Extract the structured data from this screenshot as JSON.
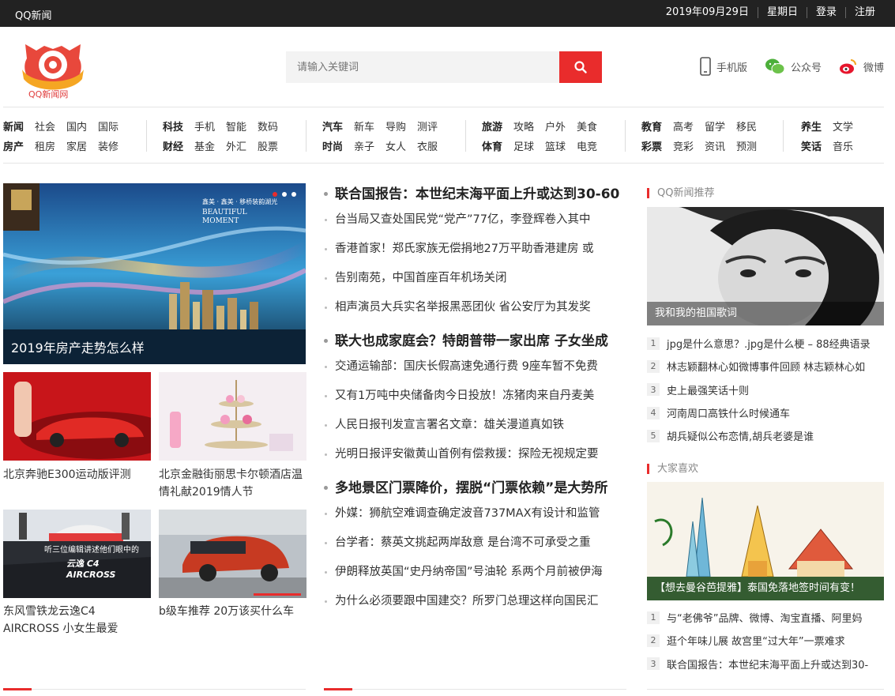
{
  "topbar": {
    "brand": "QQ新闻",
    "date": "2019年09月29日",
    "weekday": "星期日",
    "login": "登录",
    "register": "注册"
  },
  "header": {
    "logo_text": "QQ新闻网",
    "search_placeholder": "请输入关键词",
    "links": {
      "mobile": "手机版",
      "wechat": "公众号",
      "weibo": "微博"
    }
  },
  "nav": {
    "groups": [
      {
        "row1": [
          "新闻",
          "社会",
          "国内",
          "国际"
        ],
        "row2": [
          "房产",
          "租房",
          "家居",
          "装修"
        ]
      },
      {
        "row1": [
          "科技",
          "手机",
          "智能",
          "数码"
        ],
        "row2": [
          "财经",
          "基金",
          "外汇",
          "股票"
        ]
      },
      {
        "row1": [
          "汽车",
          "新车",
          "导购",
          "测评"
        ],
        "row2": [
          "时尚",
          "亲子",
          "女人",
          "衣服"
        ]
      },
      {
        "row1": [
          "旅游",
          "攻略",
          "户外",
          "美食"
        ],
        "row2": [
          "体育",
          "足球",
          "篮球",
          "电竞"
        ]
      },
      {
        "row1": [
          "教育",
          "高考",
          "留学",
          "移民"
        ],
        "row2": [
          "彩票",
          "竞彩",
          "资讯",
          "预测"
        ]
      },
      {
        "row1": [
          "养生",
          "文学"
        ],
        "row2": [
          "笑话",
          "音乐"
        ]
      }
    ]
  },
  "hero": {
    "caption": "2019年房产走势怎么样",
    "banner_lines": [
      "鑫美 · 鑫美 · 移桥装韵湖光",
      "BEAUTIFUL",
      "MOMENT"
    ]
  },
  "thumbs": [
    {
      "caption": "北京奔驰E300运动版评测"
    },
    {
      "caption": "北京金融街丽思卡尔顿酒店温情礼献2019情人节"
    },
    {
      "caption": "东风雪铁龙云逸C4 AIRCROSS 小女生最爱",
      "overlay1": "听三位编辑讲述他们眼中的",
      "overlay2": "云逸 C4 AIRCROSS"
    },
    {
      "caption": "b级车推荐 20万该买什么车"
    }
  ],
  "middle": {
    "sections": [
      {
        "headline": "联合国报告：本世纪末海平面上升或达到30-60",
        "items": [
          "台当局又查处国民党“党产”77亿，李登辉卷入其中",
          "香港首家！郑氏家族无偿捐地27万平助香港建房 或",
          "告别南苑，中国首座百年机场关闭",
          "相声演员大兵实名举报黑恶团伙 省公安厅为其发奖"
        ]
      },
      {
        "headline": "联大也成家庭会？特朗普带一家出席 子女坐成",
        "items": [
          "交通运输部：国庆长假高速免通行费 9座车暂不免费",
          "又有1万吨中央储备肉今日投放！冻猪肉来自丹麦美",
          "人民日报刊发宣言署名文章：雄关漫道真如铁",
          "光明日报评安徽黄山首例有偿救援：探险无视规定要"
        ]
      },
      {
        "headline": "多地景区门票降价，摆脱“门票依赖”是大势所",
        "items": [
          "外媒：狮航空难调查确定波音737MAX有设计和监管",
          "台学者：蔡英文挑起两岸敌意 是台湾不可承受之重",
          "伊朗释放英国“史丹纳帝国”号油轮 系两个月前被伊海",
          "为什么必须要跟中国建交？所罗门总理这样向国民汇"
        ]
      }
    ]
  },
  "right": {
    "recommend": {
      "title": "QQ新闻推荐",
      "image_caption": "我和我的祖国歌词",
      "items": [
        {
          "n": "1",
          "text": "jpg是什么意思？.jpg是什么梗 – 88经典语录"
        },
        {
          "n": "2",
          "text": "林志颖翻林心如微博事件回顾 林志颖林心如"
        },
        {
          "n": "3",
          "text": "史上最强笑话十则"
        },
        {
          "n": "4",
          "text": "河南周口高铁什么时候通车"
        },
        {
          "n": "5",
          "text": "胡兵疑似公布恋情,胡兵老婆是谁"
        }
      ]
    },
    "likes": {
      "title": "大家喜欢",
      "image_caption": "【想去曼谷芭提雅】泰国免落地签时间有变！",
      "items": [
        {
          "n": "1",
          "text": "与“老佛爷”品牌、微博、淘宝直播、阿里妈"
        },
        {
          "n": "2",
          "text": "逛个年味儿展 故宫里“过大年”一票难求"
        },
        {
          "n": "3",
          "text": "联合国报告：本世纪末海平面上升或达到30-"
        }
      ]
    }
  },
  "colors": {
    "accent": "#e92c2c",
    "topbar": "#222222"
  }
}
